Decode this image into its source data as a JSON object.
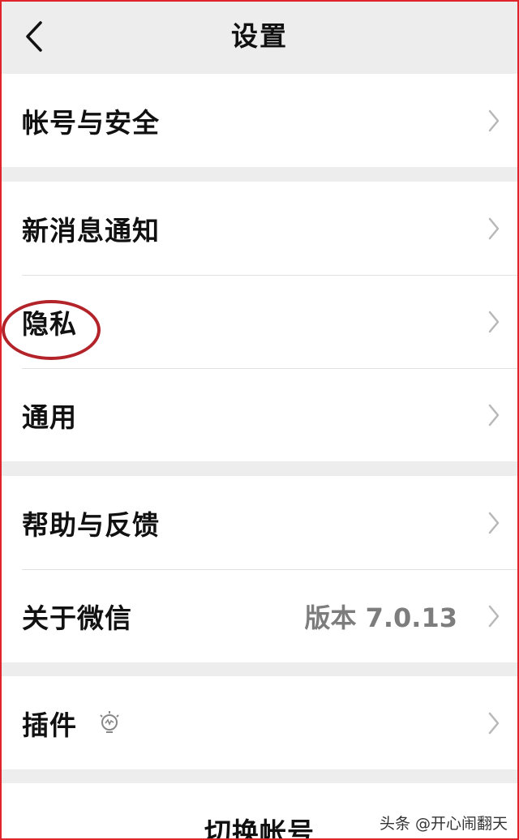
{
  "nav": {
    "title": "设置"
  },
  "groups": [
    {
      "items": [
        {
          "label": "帐号与安全"
        }
      ]
    },
    {
      "items": [
        {
          "label": "新消息通知"
        },
        {
          "label": "隐私"
        },
        {
          "label": "通用"
        }
      ]
    },
    {
      "items": [
        {
          "label": "帮助与反馈"
        },
        {
          "label": "关于微信",
          "value": "版本 7.0.13"
        }
      ]
    },
    {
      "items": [
        {
          "label": "插件"
        }
      ]
    }
  ],
  "switch_account": {
    "label": "切换帐号"
  },
  "watermark": "头条 @开心闹翻天",
  "colors": {
    "background": "#ededed",
    "annotation_circle": "#b3232a",
    "frame_border": "#e0242b"
  }
}
